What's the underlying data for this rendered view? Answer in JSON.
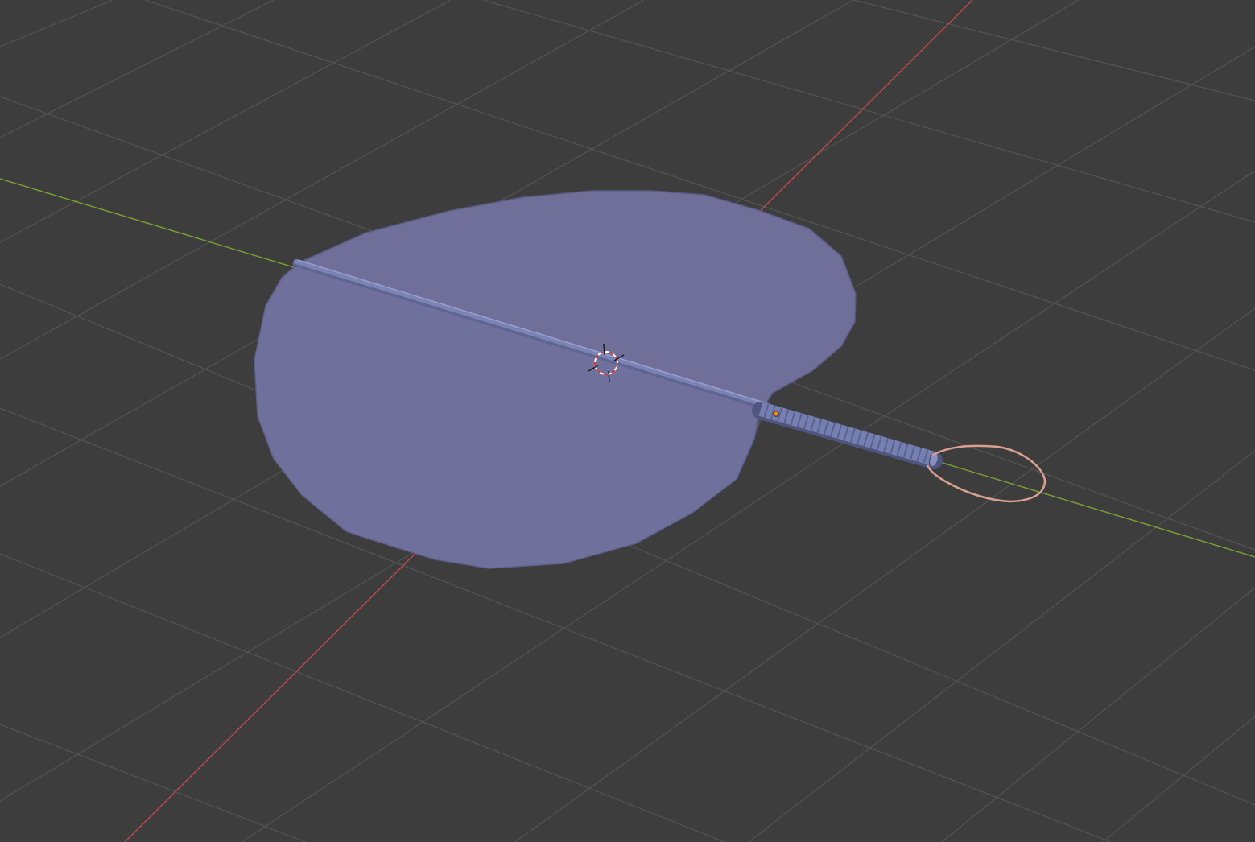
{
  "viewport": {
    "view": "3D Viewport",
    "background_color": "#3d3d3d",
    "grid_color": "#545454",
    "x_axis_color": "#c24a4a",
    "y_axis_color": "#7ba233"
  },
  "scene": {
    "objects": [
      {
        "name": "fan-blade",
        "color": "#6f6f9a",
        "edge_color": "#5b5b86"
      },
      {
        "name": "fan-rod",
        "color": "#7b82b4"
      },
      {
        "name": "fan-handle",
        "color": "#7680b0",
        "groove_color": "#5a6190"
      },
      {
        "name": "hanging-loop",
        "color": "#d8a090",
        "selected": true
      }
    ],
    "origin_color": "#f08c1a",
    "cursor_icon": "3d-cursor-icon"
  }
}
